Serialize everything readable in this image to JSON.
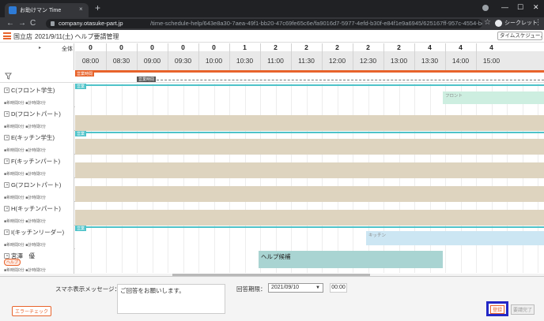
{
  "browser": {
    "tab_title": "お助けマン Time",
    "tab_close": "×",
    "new_tab": "+",
    "url_host": "company.otasuke-part.jp",
    "url_path": "/time-schedule-help/643e8a30-7aea-49f1-bb20-47c69fe65c6e/fa9016d7-5977-4efd-b30f-e84f1e9a6945/625167ff-957c-4554-bd81-90715534f109/1631286000...",
    "incognito_label": "シークレット",
    "win_min": "—",
    "win_max": "☐",
    "win_close": "✕",
    "back": "←",
    "forward": "→",
    "reload": "C",
    "star": "☆",
    "menu": "⋮"
  },
  "header": {
    "store": "国立店",
    "title": "2021/9/11(土) ヘルプ要請管理",
    "timeline_button": "タイムスケジュール"
  },
  "grid": {
    "expand_arrow": "▸",
    "all_label": "全体",
    "counts": [
      "0",
      "0",
      "0",
      "0",
      "0",
      "1",
      "2",
      "2",
      "2",
      "2",
      "2",
      "4",
      "4",
      "4"
    ],
    "times": [
      "08:00",
      "08:30",
      "09:00",
      "09:30",
      "10:00",
      "10:30",
      "11:00",
      "11:30",
      "12:00",
      "12:30",
      "13:00",
      "13:30",
      "14:00",
      "15:00"
    ]
  },
  "filter_row": {
    "business_hours_label": "営業時間",
    "open_hours_label": "営業時間"
  },
  "rows": [
    {
      "name": "C(フロント学生)",
      "hours": "■希時間0分 ■計時間0分",
      "tag": "営業"
    },
    {
      "name": "D(フロントパート)",
      "hours": "■希時間0分 ■計時間0分",
      "tag": ""
    },
    {
      "name": "E(キッチン学生)",
      "hours": "■希時間0分 ■計時間0分",
      "tag": "営業"
    },
    {
      "name": "F(キッチンパート)",
      "hours": "■希時間0分 ■計時間0分",
      "tag": ""
    },
    {
      "name": "G(フロントパート)",
      "hours": "■希時間0分 ■計時間0分",
      "tag": ""
    },
    {
      "name": "H(キッチンパート)",
      "hours": "■希時間0分 ■計時間0分",
      "tag": ""
    },
    {
      "name": "I(キッチンリーダー)",
      "hours": "■希時間0分 ■計時間0分",
      "tag": "営業"
    },
    {
      "name": "宮澤　優",
      "hours": "■希時間0分 ■計時間0分",
      "tag": ""
    }
  ],
  "shift_blocks": {
    "c_label": "フロント",
    "i_label": "キッチン"
  },
  "helper_badge": "ヘルプ",
  "help_block_label": "ヘルプ候補",
  "footer": {
    "error_check": "エラーチェック",
    "message_label": "スマホ表示メッセージ：",
    "message_value": "ご回答をお願いします。",
    "deadline_label": "回答期限：",
    "deadline_date": "2021/09/10",
    "deadline_arrow": "▼",
    "deadline_time": "00:00",
    "register": "登録",
    "request_done": "要請完了"
  },
  "colors": {
    "accent": "#e8632b",
    "teal": "#4fc3c9",
    "shade": "#ded4bf",
    "help_block": "#a9d4d2",
    "focus_frame": "#2328c6"
  }
}
